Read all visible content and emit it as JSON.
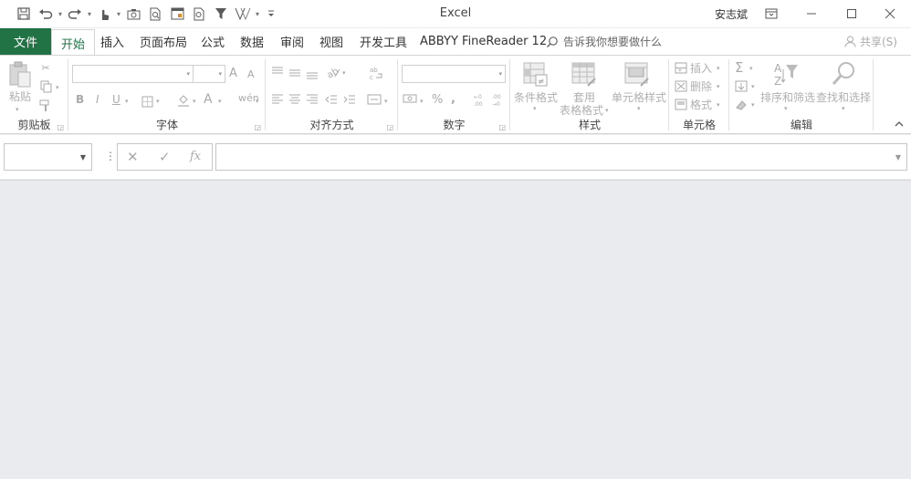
{
  "window": {
    "title": "Excel",
    "user": "安志斌"
  },
  "quick_access": {
    "icons": [
      "save-icon",
      "undo-icon",
      "redo-icon",
      "touch-mode-icon",
      "camera-icon",
      "print-preview-icon",
      "form-icon",
      "zoom-preview-icon",
      "filter-icon",
      "sort-icon",
      "customize-icon"
    ]
  },
  "tabs": {
    "file": "文件",
    "home": "开始",
    "insert": "插入",
    "page_layout": "页面布局",
    "formulas": "公式",
    "data": "数据",
    "review": "审阅",
    "view": "视图",
    "developer": "开发工具",
    "abbyy": "ABBYY FineReader 12",
    "tell_me": "告诉我你想要做什么",
    "share": "共享(S)"
  },
  "ribbon": {
    "clipboard": {
      "label": "剪贴板",
      "paste": "粘贴"
    },
    "font": {
      "label": "字体",
      "bold": "B",
      "italic": "I",
      "underline": "U",
      "grow": "A",
      "shrink": "A"
    },
    "alignment": {
      "label": "对齐方式"
    },
    "number": {
      "label": "数字",
      "percent": "%",
      "comma": ","
    },
    "styles": {
      "label": "样式",
      "conditional": "条件格式",
      "table_format_1": "套用",
      "table_format_2": "表格格式",
      "cell_styles": "单元格样式"
    },
    "cells": {
      "label": "单元格",
      "insert": "插入",
      "delete": "删除",
      "format": "格式"
    },
    "editing": {
      "label": "编辑",
      "sort_filter": "排序和筛选",
      "find_select": "查找和选择"
    }
  },
  "formula_bar": {
    "name_box": "",
    "formula": "",
    "cancel": "✕",
    "enter": "✓",
    "fx": "fx"
  }
}
